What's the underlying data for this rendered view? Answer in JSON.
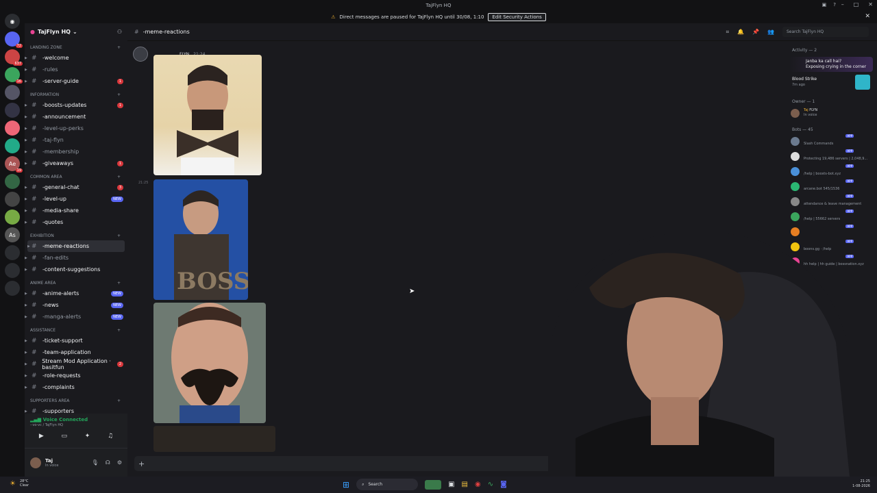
{
  "window": {
    "title": "TajFlyn HQ"
  },
  "banner": {
    "text": "Direct messages are paused for TajFlyn HQ until 30/08, 1:10",
    "button": "Edit Security Actions"
  },
  "server_rail": [
    {
      "badge": "72",
      "color": "#5865f2"
    },
    {
      "badge": "637",
      "color": "#c44"
    },
    {
      "badge": "16",
      "color": "#3ba55d"
    },
    {
      "badge": "",
      "color": "#556"
    },
    {
      "badge": "",
      "color": "#334"
    },
    {
      "badge": "",
      "color": "#e67"
    },
    {
      "badge": "",
      "color": "#2a8"
    },
    {
      "badge": "19",
      "color": "#a55"
    },
    {
      "badge": "",
      "color": "#364"
    },
    {
      "badge": "",
      "color": "#444"
    },
    {
      "badge": "",
      "color": "#7a4"
    },
    {
      "badge": "",
      "color": "#555"
    },
    {
      "badge": "",
      "color": "#2b2d31"
    },
    {
      "badge": "",
      "color": "#2b2d31"
    },
    {
      "badge": "",
      "color": "#2b2d31"
    }
  ],
  "server_rail_labels": {
    "ae": "Ae",
    "as": "As"
  },
  "guild": {
    "name": "TajFlyn HQ"
  },
  "channels": {
    "landing_zone": "LANDING ZONE",
    "information": "INFORMATION",
    "common_area": "COMMON AREA",
    "exhibition": "EXHIBITION",
    "anime_area": "ANIME AREA",
    "assistance": "ASSISTANCE",
    "supporters_area": "SUPPORTERS AREA",
    "items": [
      {
        "name": "-welcome",
        "bright": true,
        "badge": "",
        "badge_type": ""
      },
      {
        "name": "-rules",
        "bright": false,
        "badge": "",
        "badge_type": ""
      },
      {
        "name": "-server-guide",
        "bright": true,
        "badge": "1",
        "badge_type": "count"
      },
      {
        "name": "-boosts-updates",
        "bright": true,
        "badge": "1",
        "badge_type": "count"
      },
      {
        "name": "-announcement",
        "bright": true,
        "badge": "",
        "badge_type": ""
      },
      {
        "name": "-level-up-perks",
        "bright": false,
        "badge": "",
        "badge_type": ""
      },
      {
        "name": "-taj-flyn",
        "bright": false,
        "badge": "",
        "badge_type": ""
      },
      {
        "name": "-membership",
        "bright": false,
        "badge": "",
        "badge_type": ""
      },
      {
        "name": "-giveaways",
        "bright": true,
        "badge": "1",
        "badge_type": "count"
      },
      {
        "name": "-general-chat",
        "bright": true,
        "badge": "3",
        "badge_type": "count"
      },
      {
        "name": "-level-up",
        "bright": true,
        "badge": "NEW",
        "badge_type": "new"
      },
      {
        "name": "-media-share",
        "bright": true,
        "badge": "",
        "badge_type": ""
      },
      {
        "name": "-quotes",
        "bright": true,
        "badge": "",
        "badge_type": ""
      },
      {
        "name": "-meme-reactions",
        "bright": true,
        "badge": "",
        "badge_type": "",
        "selected": true
      },
      {
        "name": "-fan-edits",
        "bright": false,
        "badge": "",
        "badge_type": ""
      },
      {
        "name": "-content-suggestions",
        "bright": true,
        "badge": "",
        "badge_type": ""
      },
      {
        "name": "-anime-alerts",
        "bright": true,
        "badge": "NEW",
        "badge_type": "new"
      },
      {
        "name": "-news",
        "bright": true,
        "badge": "NEW",
        "badge_type": "new"
      },
      {
        "name": "-manga-alerts",
        "bright": false,
        "badge": "NEW",
        "badge_type": "new"
      },
      {
        "name": "-ticket-support",
        "bright": true,
        "badge": "",
        "badge_type": ""
      },
      {
        "name": "-team-application",
        "bright": true,
        "badge": "",
        "badge_type": ""
      },
      {
        "name": "Stream Mod Application · basitfun",
        "bright": true,
        "badge": "2",
        "badge_type": "count"
      },
      {
        "name": "-role-requests",
        "bright": true,
        "badge": "",
        "badge_type": ""
      },
      {
        "name": "-complaints",
        "bright": true,
        "badge": "",
        "badge_type": ""
      },
      {
        "name": "-supporters",
        "bright": true,
        "badge": "",
        "badge_type": ""
      }
    ]
  },
  "voice": {
    "status": "Voice Connected",
    "sub": "-·vo-vc / TajFlyn HQ"
  },
  "user": {
    "name": "Taj",
    "status": "In voice"
  },
  "header": {
    "channel": "-meme-reactions",
    "search_placeholder": "Search TajFlyn HQ"
  },
  "messages": {
    "author": "FLYN",
    "time1": "21:24",
    "time2": "21:25"
  },
  "members": {
    "activity": "Activity — 2",
    "feature1_line1": "Janba ka call hai?",
    "feature1_line2": "Exposing crying in the corner",
    "feature2_name": "Blood Strike",
    "feature2_time": "7m ago",
    "owner_head": "Owner — 1",
    "owner_name": "Taj",
    "owner_tag": "FLYN",
    "owner_status": "In voice",
    "bots_head": "Bots — 45",
    "bots": [
      {
        "text": "Slash Commands",
        "color": "#6b7a8f"
      },
      {
        "text": "Protecting 19,486 servers | 2,048,9...",
        "color": "#ddd"
      },
      {
        "text": "/help | boosts-bot.xyz",
        "color": "#4a90d9"
      },
      {
        "text": "arcane.bot 545/1536",
        "color": "#2bb673"
      },
      {
        "text": "attendance & leave management",
        "color": "#888"
      },
      {
        "text": "/help | 55662 servers",
        "color": "#3ba55d"
      },
      {
        "text": "",
        "color": "#e67e22"
      },
      {
        "text": "boons.gg · /help",
        "color": "#f1c40f"
      },
      {
        "text": "hh help | hh guide | bossnation.xyz",
        "color": "#e84393"
      }
    ],
    "app_label": "APP"
  },
  "taskbar": {
    "temp": "28°C",
    "weather": "Clear",
    "search": "Search",
    "time": "21:25",
    "date": "1-08-2026"
  }
}
